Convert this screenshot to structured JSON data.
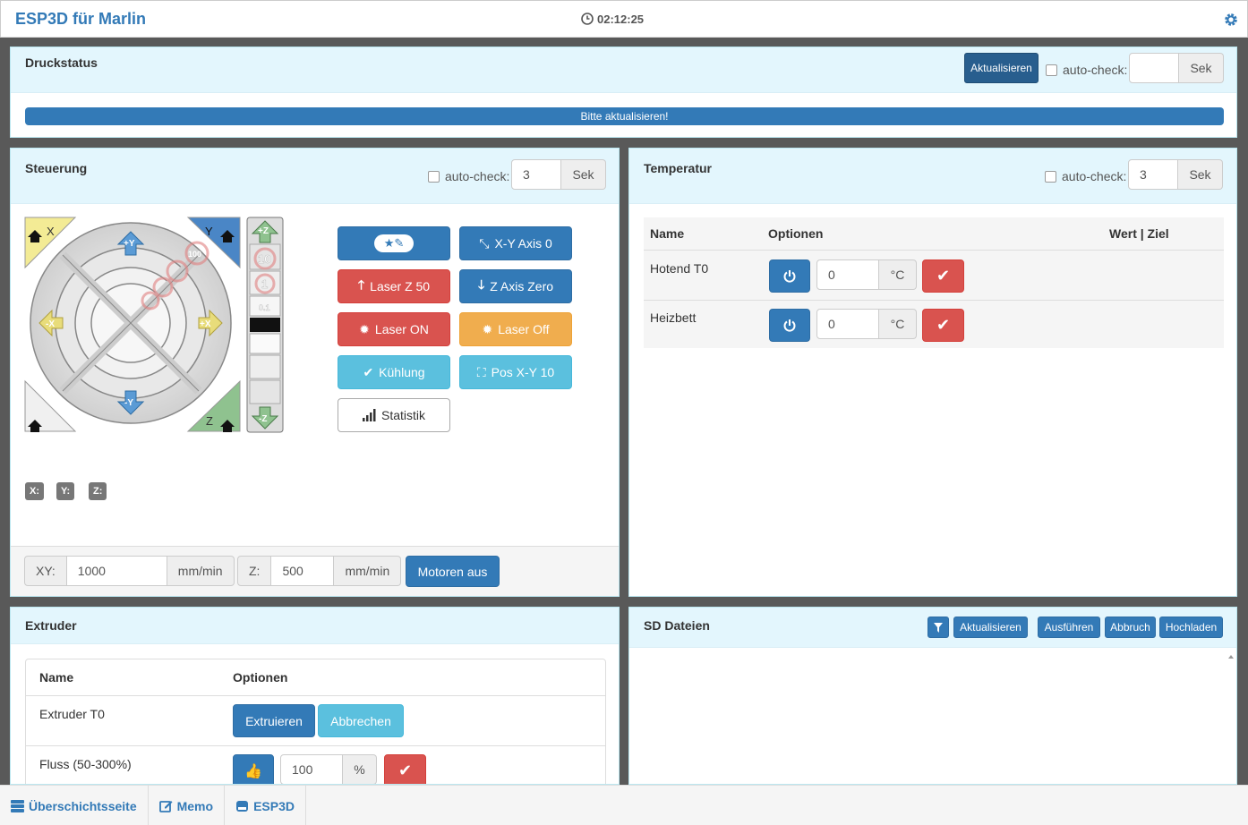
{
  "app": {
    "title": "ESP3D für Marlin",
    "time": "02:12:25"
  },
  "status": {
    "title": "Druckstatus",
    "refresh_label": "Aktualisieren",
    "autocheck_label": "auto-check:",
    "interval_value": "",
    "unit": "Sek",
    "progress_text": "Bitte aktualisieren!"
  },
  "control": {
    "title": "Steuerung",
    "autocheck_label": "auto-check:",
    "interval_value": "3",
    "unit": "Sek",
    "jog": {
      "x_home": "X",
      "y_home": "Y",
      "z_home": "Z",
      "plus_y": "+Y",
      "minus_y": "-Y",
      "plus_x": "+X",
      "minus_x": "-X",
      "plus_z": "+Z",
      "minus_z": "-Z",
      "step_100": "100",
      "step_10": "10",
      "step_1": "1",
      "step_01": "0.1"
    },
    "macros": [
      "",
      "X-Y Axis 0",
      "Laser Z 50",
      "Z Axis Zero",
      "Laser ON",
      "Laser Off",
      "Kühlung",
      "Pos X-Y 10",
      "Statistik"
    ],
    "positions": {
      "x": "X:",
      "y": "Y:",
      "z": "Z:"
    },
    "feed": {
      "xy_label": "XY:",
      "xy_value": "1000",
      "xy_unit": "mm/min",
      "z_label": "Z:",
      "z_value": "500",
      "z_unit": "mm/min",
      "motors_off": "Motoren aus"
    }
  },
  "temperature": {
    "title": "Temperatur",
    "autocheck_label": "auto-check:",
    "interval_value": "3",
    "unit": "Sek",
    "headers": {
      "name": "Name",
      "options": "Optionen",
      "value": "Wert | Ziel"
    },
    "rows": [
      {
        "name": "Hotend T0",
        "value": "0",
        "unit": "°C"
      },
      {
        "name": "Heizbett",
        "value": "0",
        "unit": "°C"
      }
    ]
  },
  "extruder": {
    "title": "Extruder",
    "headers": {
      "name": "Name",
      "options": "Optionen"
    },
    "rows": [
      {
        "name": "Extruder T0",
        "extrude_label": "Extruieren",
        "cancel_label": "Abbrechen"
      },
      {
        "name": "Fluss (50-300%)",
        "value": "100",
        "unit": "%"
      }
    ]
  },
  "sd": {
    "title": "SD Dateien",
    "refresh_label": "Aktualisieren",
    "run_label": "Ausführen",
    "abort_label": "Abbruch",
    "upload_label": "Hochladen"
  },
  "footer": {
    "overview": "Überschichtsseite",
    "memo": "Memo",
    "esp3d": "ESP3D"
  },
  "colors": {
    "primary": "#337ab7",
    "danger": "#d9534f",
    "warning": "#f0ad4e",
    "info": "#5bc0de",
    "header_bg": "#e3f6fd"
  }
}
